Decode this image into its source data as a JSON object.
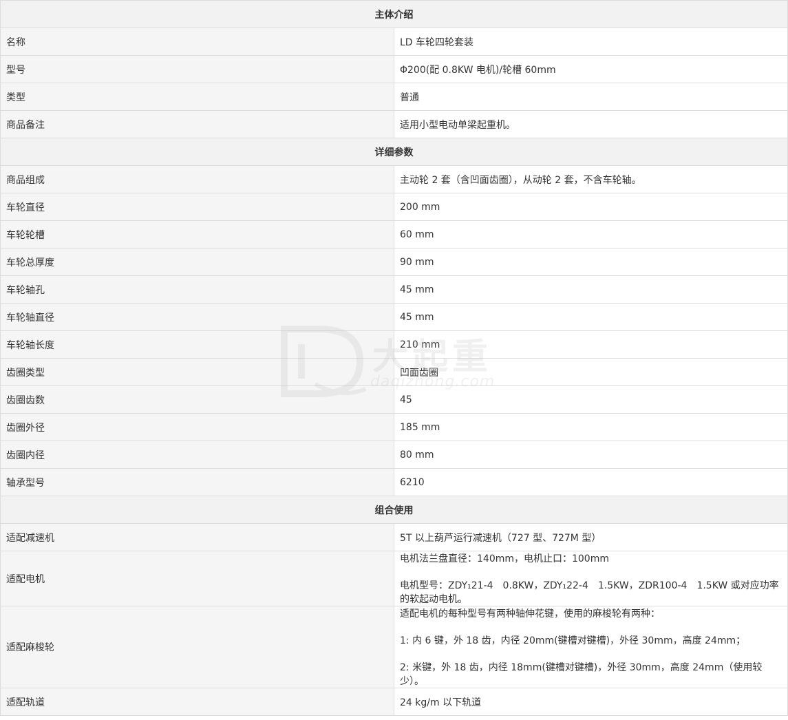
{
  "sections": [
    {
      "title": "主体介绍",
      "rows": [
        {
          "label": "名称",
          "lines": [
            "LD 车轮四轮套装"
          ]
        },
        {
          "label": "型号",
          "lines": [
            "Φ200(配 0.8KW 电机)/轮槽 60mm"
          ]
        },
        {
          "label": "类型",
          "lines": [
            "普通"
          ]
        },
        {
          "label": "商品备注",
          "lines": [
            "适用小型电动单梁起重机。"
          ]
        }
      ]
    },
    {
      "title": "详细参数",
      "rows": [
        {
          "label": "商品组成",
          "lines": [
            "主动轮 2 套（含凹面齿圈），从动轮 2 套，不含车轮轴。"
          ]
        },
        {
          "label": "车轮直径",
          "lines": [
            "200 mm"
          ]
        },
        {
          "label": "车轮轮槽",
          "lines": [
            "60 mm"
          ]
        },
        {
          "label": "车轮总厚度",
          "lines": [
            "90 mm"
          ]
        },
        {
          "label": "车轮轴孔",
          "lines": [
            "45 mm"
          ]
        },
        {
          "label": "车轮轴直径",
          "lines": [
            "45 mm"
          ]
        },
        {
          "label": "车轮轴长度",
          "lines": [
            "210 mm"
          ]
        },
        {
          "label": "齿圈类型",
          "lines": [
            "凹面齿圈"
          ]
        },
        {
          "label": "齿圈齿数",
          "lines": [
            "45"
          ]
        },
        {
          "label": "齿圈外径",
          "lines": [
            "185 mm"
          ]
        },
        {
          "label": "齿圈内径",
          "lines": [
            "80 mm"
          ]
        },
        {
          "label": "轴承型号",
          "lines": [
            "6210"
          ]
        }
      ]
    },
    {
      "title": "组合使用",
      "rows": [
        {
          "label": "适配减速机",
          "lines": [
            "5T 以上葫芦运行减速机（727 型、727M 型）"
          ]
        },
        {
          "label": "适配电机",
          "lines": [
            "电机法兰盘直径：140mm，电机止口：100mm",
            "电机型号：ZDY₁21-4　0.8KW，ZDY₁22-4　1.5KW，ZDR100-4　1.5KW 或对应功率的软起动电机。"
          ]
        },
        {
          "label": "适配麻梭轮",
          "lines": [
            "适配电机的每种型号有两种轴伸花键，使用的麻梭轮有两种：",
            "1:  内 6 键，外 18 齿，内径 20mm(键槽对键槽)，外径 30mm，高度 24mm；",
            "2:  米键，外 18 齿，内径 18mm(键槽对键槽)，外径 30mm，高度 24mm（使用较少）。"
          ]
        },
        {
          "label": "适配轨道",
          "lines": [
            "24 kg/m 以下轨道"
          ]
        }
      ]
    }
  ],
  "watermark": {
    "cn": "大起重",
    "en": "daqizhong.com"
  }
}
